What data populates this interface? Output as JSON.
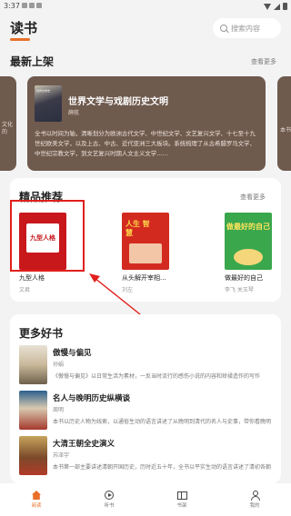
{
  "status_bar": {
    "time": "3:37"
  },
  "header": {
    "title": "读书",
    "search_placeholder": "搜索内容"
  },
  "latest": {
    "title": "最新上架",
    "see_all": "查看更多",
    "left_strip": "文化的",
    "right_strip": "本书",
    "featured": {
      "cover_label": "世界文学史",
      "title": "世界文学与戏剧历史文明",
      "author": "薛航",
      "desc": "全书以时间为轴，清晰划分为欧洲古代文学、中世纪文学、文艺复兴文学、十七至十九世纪欧美文学，以及上古、中古、近代亚洲三大板块。系统梳理了从古希腊罗马文学、中世纪宗教文学，到文艺复兴时期人文主义文学……"
    }
  },
  "recommended": {
    "title": "精品推荐",
    "see_all": "查看更多",
    "items": [
      {
        "title": "九型人格",
        "author": "文君",
        "cover_text": "九型人格"
      },
      {
        "title": "从头解开宰相...",
        "author": "刘左",
        "cover_text": "人生 智慧"
      },
      {
        "title": "做最好的自己",
        "author": "李飞 关玉琴",
        "cover_text": "做最好的自己"
      }
    ]
  },
  "more_books": {
    "title": "更多好书",
    "items": [
      {
        "title": "傲慢与偏见",
        "author": "孙娟",
        "desc": "《傲慢与偏见》以日常生活为素材，一反当时流行的感伤小说的内容和矫揉造作的写作"
      },
      {
        "title": "名人与晚明历史纵横谈",
        "author": "周明",
        "desc": "本书以历史人物为线索，以通俗生动的语言讲述了从晚明到清代的名人与史事，带你看晚明"
      },
      {
        "title": "大清王朝全史演义",
        "author": "苏泽宇",
        "desc": "本书第一部主要讲述清朝开国历史，历时近五十年，全书以平实生动的语言讲述了清初各朝"
      }
    ]
  },
  "bottom_nav": [
    {
      "label": "阅读",
      "icon": "home-icon",
      "active": true
    },
    {
      "label": "听书",
      "icon": "play-icon",
      "active": false
    },
    {
      "label": "书架",
      "icon": "book-icon",
      "active": false
    },
    {
      "label": "我的",
      "icon": "user-icon",
      "active": false
    }
  ],
  "colors": {
    "accent": "#e8702a",
    "highlight": "#e0201c",
    "banner": "#6f5a4e"
  }
}
